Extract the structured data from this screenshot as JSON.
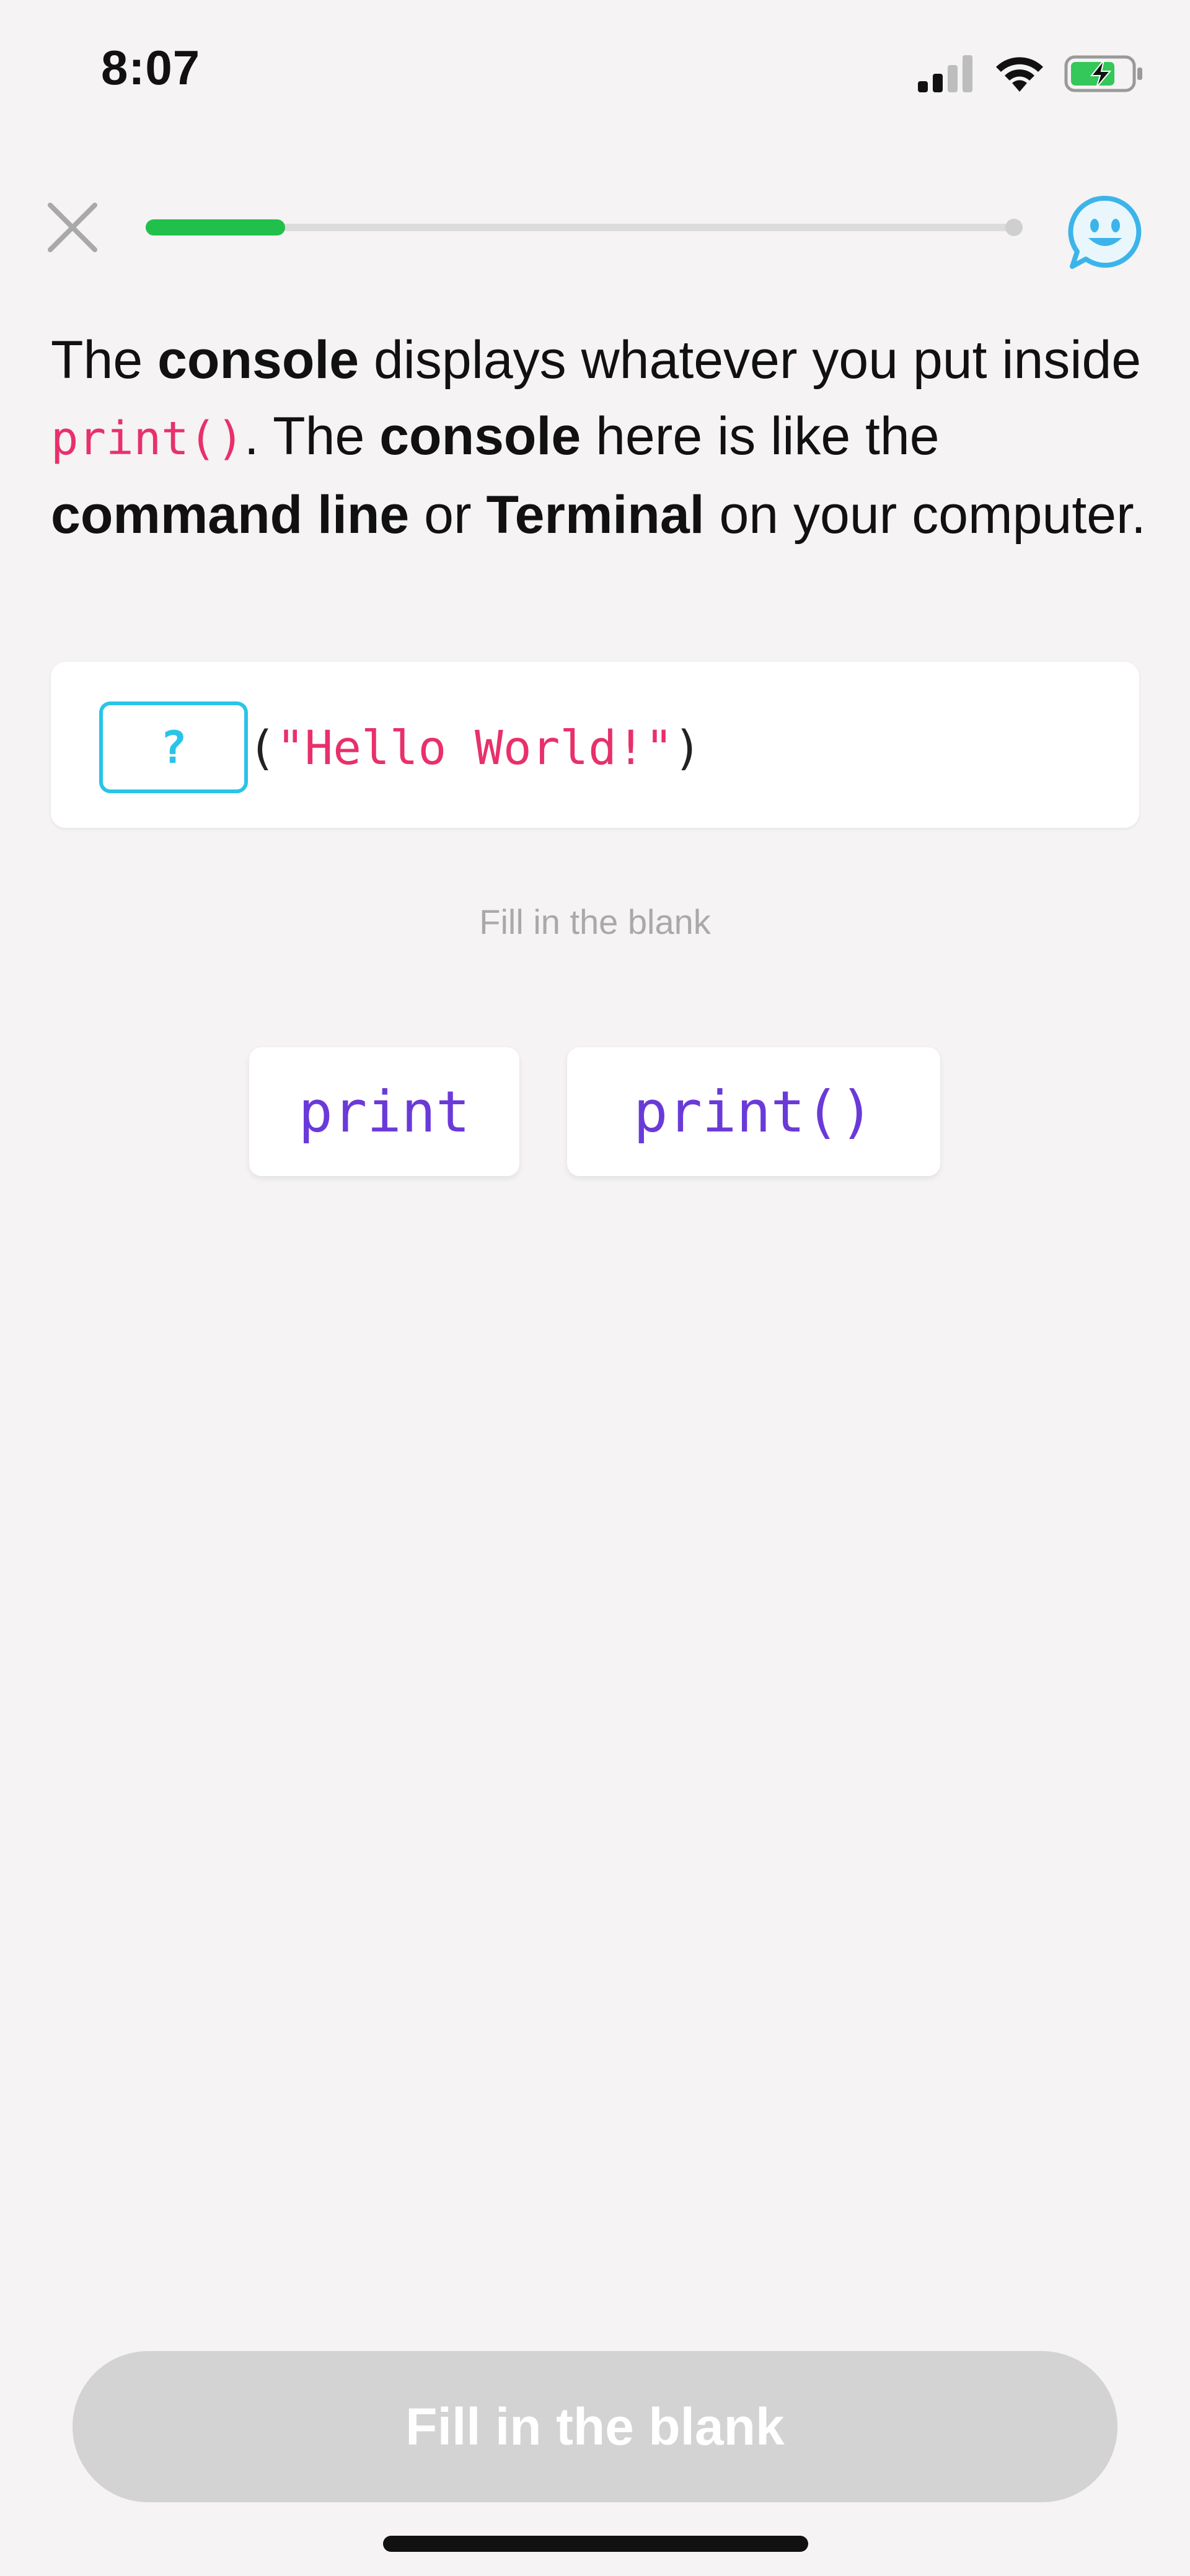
{
  "status_bar": {
    "time": "8:07"
  },
  "progress": {
    "fraction": 0.16,
    "color": "#21c04a"
  },
  "icons": {
    "close": "close-icon",
    "chat": "chat-face-icon",
    "signal": "cellular-signal-icon",
    "wifi": "wifi-icon",
    "battery": "battery-charging-icon"
  },
  "lesson": {
    "part1": "The ",
    "b1": "console",
    "part2": " displays whatever you put inside ",
    "code1": "print()",
    "part3": ". The ",
    "b2": "console",
    "part4": " here is like the ",
    "b3": "command line",
    "part5": " or ",
    "b4": "Terminal",
    "part6": " on your computer."
  },
  "code": {
    "blank": "?",
    "open_paren": "(",
    "string": "\"Hello World!\"",
    "close_paren": ")"
  },
  "hint": "Fill in the blank",
  "options": [
    {
      "label": "print"
    },
    {
      "label": "print()"
    }
  ],
  "action_button": {
    "label": "Fill in the blank"
  },
  "colors": {
    "accent_blank": "#29c4e8",
    "string": "#e8306b",
    "option_text": "#6a3ad9",
    "button_disabled": "#d3d3d3"
  }
}
